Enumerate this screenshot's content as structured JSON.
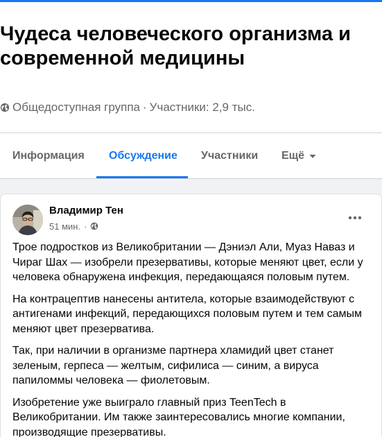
{
  "group": {
    "title": "Чудеса человеческого организма и современной медицины",
    "privacy": "Общедоступная группа",
    "separator": "·",
    "members": "Участники: 2,9 тыс."
  },
  "tabs": [
    {
      "label": "Информация",
      "active": false
    },
    {
      "label": "Обсуждение",
      "active": true
    },
    {
      "label": "Участники",
      "active": false
    },
    {
      "label": "Ещё",
      "active": false
    }
  ],
  "post": {
    "author": "Владимир Тен",
    "time": "51 мин.",
    "separator": "·",
    "paragraphs": [
      "Трое подростков из Великобритании — Дэниэл Али, Муаз Наваз и Чираг Шах — изобрели презервативы, которые меняют цвет, если у человека обнаружена инфекция, передающаяся половым путем.",
      "На контрацептив нанесены антитела, которые взаимодействуют с антигенами инфекций, передающихся половым путем и тем самым меняют цвет презерватива.",
      "Так, при наличии в организме партнера хламидий цвет станет зеленым, герпеса — желтым, сифилиса — синим, а вируса папиломмы человека — фиолетовым.",
      "Изобретение уже выиграло главный приз TeenTech в Великобритании. Им также заинтересовались многие компании, производящие презервативы."
    ]
  },
  "icons": {
    "privacy": "globe-icon",
    "post_audience": "globe-icon",
    "more_tab": "caret-down-icon",
    "post_menu": "more-horizontal-icon"
  },
  "colors": {
    "accent": "#1877f2",
    "secondary_text": "#65676b",
    "primary_text": "#050505",
    "background": "#f0f2f5"
  }
}
